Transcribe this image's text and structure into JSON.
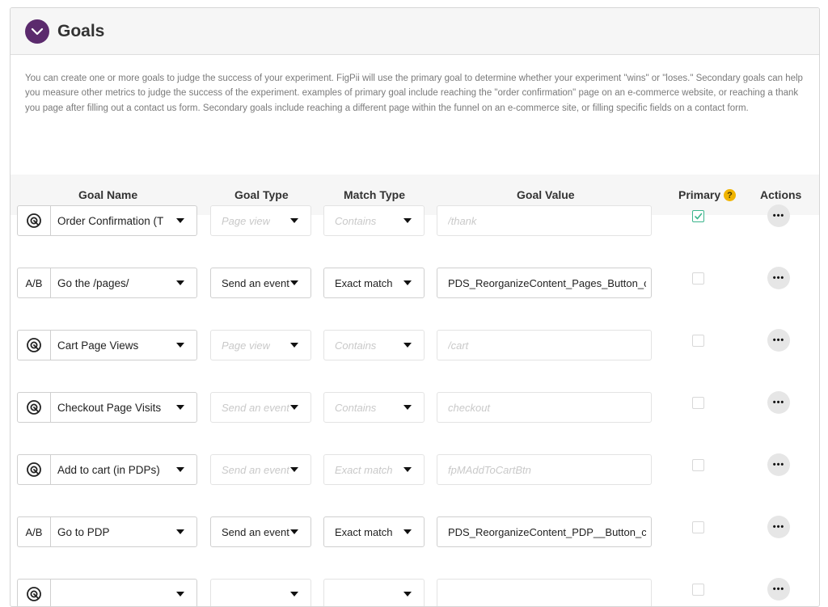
{
  "header": {
    "title": "Goals",
    "icon": "chevron-down-icon",
    "badge_color": "#5b2a6d"
  },
  "description": "You can create one or more goals to judge the success of your experiment. FigPii will use the primary goal to determine whether your experiment \"wins\" or \"loses.\" Secondary goals can help you measure other metrics to judge the success of the experiment. examples of primary goal include reaching the \"order confirmation\" page on an e-commerce website, or reaching a thank you page after filling out a contact us form. Secondary goals include reaching a different page within the funnel on an e-commerce site, or filling specific fields on a contact form.",
  "table": {
    "columns": {
      "goal_name": "Goal Name",
      "goal_type": "Goal Type",
      "match_type": "Match Type",
      "goal_value": "Goal Value",
      "primary": "Primary",
      "primary_help": "?",
      "actions": "Actions"
    },
    "rows": [
      {
        "prefix_type": "target-icon",
        "prefix_label": "",
        "name": "Order Confirmation (T",
        "goal_type": "Page view",
        "match_type": "Contains",
        "goal_value": "/thank",
        "muted": true,
        "primary": true,
        "actions": "•••"
      },
      {
        "prefix_type": "text",
        "prefix_label": "A/B",
        "name": "Go the /pages/",
        "goal_type": "Send an event",
        "match_type": "Exact match",
        "goal_value": "PDS_ReorganizeContent_Pages_Button_clic",
        "muted": false,
        "primary": false,
        "actions": "•••"
      },
      {
        "prefix_type": "target-icon",
        "prefix_label": "",
        "name": "Cart Page Views",
        "goal_type": "Page view",
        "match_type": "Contains",
        "goal_value": "/cart",
        "muted": true,
        "primary": false,
        "actions": "•••"
      },
      {
        "prefix_type": "target-icon",
        "prefix_label": "",
        "name": "Checkout Page Visits",
        "goal_type": "Send an event",
        "match_type": "Contains",
        "goal_value": "checkout",
        "muted": true,
        "primary": false,
        "actions": "•••"
      },
      {
        "prefix_type": "target-icon",
        "prefix_label": "",
        "name": "Add to cart (in PDPs)",
        "goal_type": "Send an event",
        "match_type": "Exact match",
        "goal_value": "fpMAddToCartBtn",
        "muted": true,
        "primary": false,
        "actions": "•••"
      },
      {
        "prefix_type": "text",
        "prefix_label": "A/B",
        "name": "Go to PDP",
        "goal_type": "Send an event",
        "match_type": "Exact match",
        "goal_value": "PDS_ReorganizeContent_PDP__Button_click",
        "muted": false,
        "primary": false,
        "actions": "•••"
      },
      {
        "prefix_type": "target-icon",
        "prefix_label": "",
        "name": "",
        "goal_type": "",
        "match_type": "",
        "goal_value": "",
        "muted": true,
        "primary": false,
        "actions": "•••"
      }
    ]
  }
}
